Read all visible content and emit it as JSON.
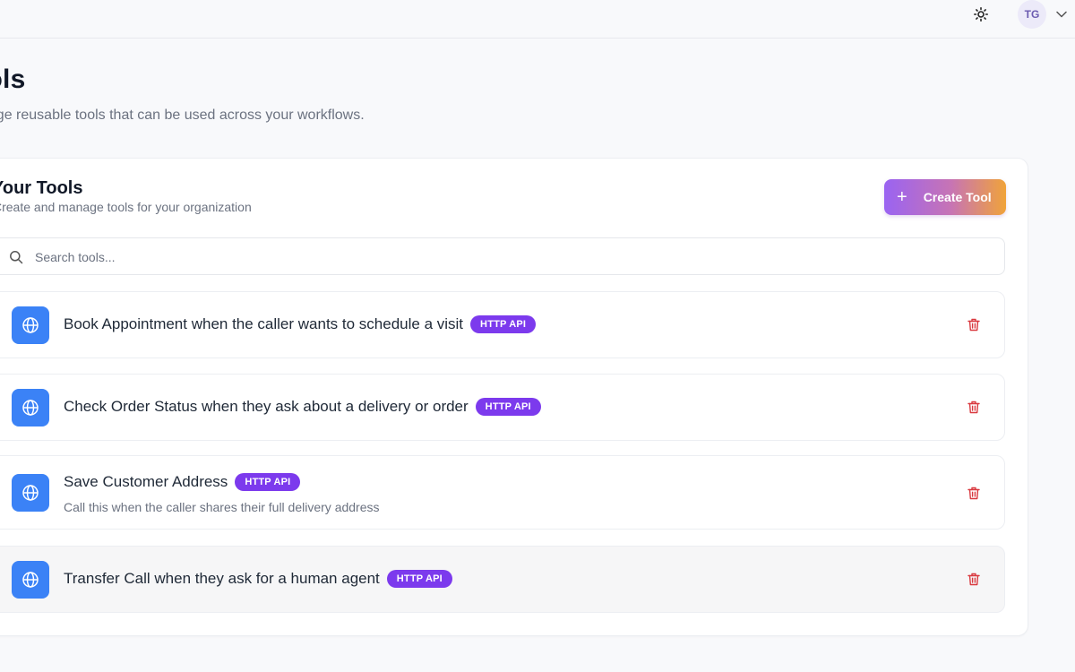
{
  "header": {
    "theme_icon": "sun-icon",
    "user_initials": "TG",
    "menu_icon": "chevron-down-icon"
  },
  "page": {
    "title": "ools",
    "subtitle": "nage reusable tools that can be used across your workflows."
  },
  "tools_card": {
    "title": "Your Tools",
    "subtitle": "Create and manage tools for your organization",
    "create_button_label": "Create Tool",
    "create_button_icon": "plus-icon"
  },
  "search": {
    "placeholder": "Search tools...",
    "value": ""
  },
  "tools": [
    {
      "name": "Book Appointment when the caller wants to schedule a visit",
      "badge": "HTTP API",
      "description": "",
      "icon": "globe-icon"
    },
    {
      "name": "Check Order Status when they ask about a delivery or order",
      "badge": "HTTP API",
      "description": "",
      "icon": "globe-icon"
    },
    {
      "name": "Save Customer Address",
      "badge": "HTTP API",
      "description": "Call this when the caller shares their full delivery address",
      "icon": "globe-icon"
    },
    {
      "name": "Transfer Call when they ask for a human agent",
      "badge": "HTTP API",
      "description": "",
      "icon": "globe-icon"
    }
  ],
  "colors": {
    "badge": "#7c3aed",
    "tool_icon_bg": "#3b82f6",
    "delete_icon": "#d9393f",
    "create_gradient_start": "#9a63f2",
    "create_gradient_end": "#f0a33a"
  }
}
